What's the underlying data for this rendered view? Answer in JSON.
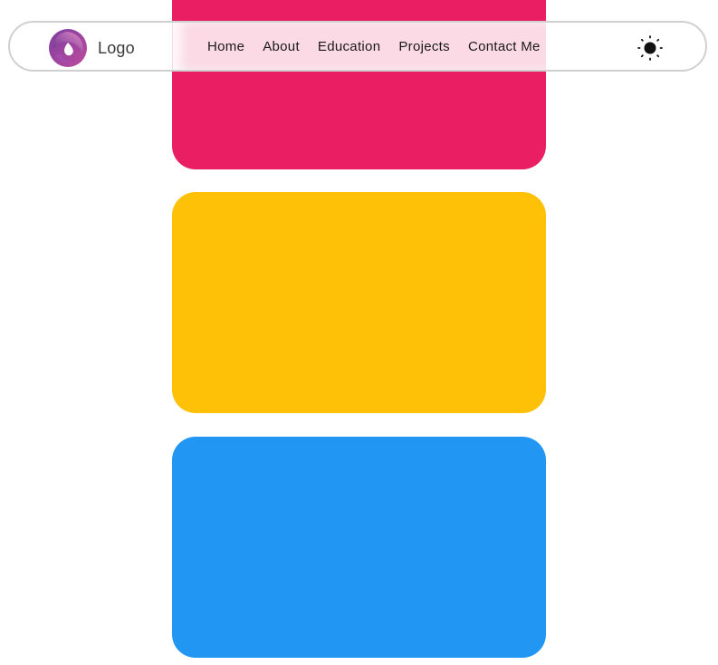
{
  "colors": {
    "card_1": "#E91E63",
    "card_2": "#FFC107",
    "card_3": "#2196F3",
    "navbar_border": "#d0d0d0",
    "text": "#1a1a1a"
  },
  "navbar": {
    "logo_icon": "swirl-logo-icon",
    "logo_label": "Logo",
    "links": [
      {
        "label": "Home"
      },
      {
        "label": "About"
      },
      {
        "label": "Education"
      },
      {
        "label": "Projects"
      },
      {
        "label": "Contact Me"
      }
    ],
    "theme_toggle_icon": "sun-icon"
  }
}
